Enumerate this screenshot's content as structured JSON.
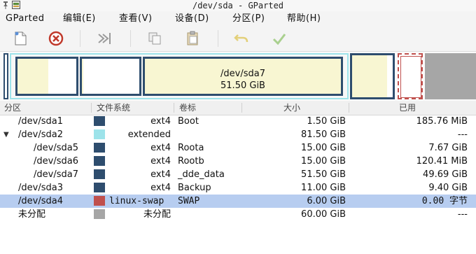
{
  "window": {
    "title": "/dev/sda - GParted"
  },
  "menubar": {
    "items": [
      {
        "label": "GParted"
      },
      {
        "label": "编辑(E)"
      },
      {
        "label": "查看(V)"
      },
      {
        "label": "设备(D)"
      },
      {
        "label": "分区(P)"
      },
      {
        "label": "帮助(H)"
      }
    ]
  },
  "toolbar": {
    "icons": [
      "new-partition-icon",
      "delete-partition-icon",
      "resize-move-icon",
      "copy-icon",
      "paste-icon",
      "undo-icon",
      "apply-icon"
    ]
  },
  "graph": {
    "selected_label": "/dev/sda7",
    "selected_size": "51.50 GiB"
  },
  "table": {
    "headers": [
      "分区",
      "文件系统",
      "卷标",
      "大小",
      "已用"
    ],
    "rows": [
      {
        "partition": "/dev/sda1",
        "fs": "ext4",
        "label": "Boot",
        "size": "1.50 GiB",
        "used": "185.76 MiB",
        "color": "#2e4d6e"
      },
      {
        "partition": "/dev/sda2",
        "fs": "extended",
        "label": "",
        "size": "81.50 GiB",
        "used": "---",
        "color": "#9de3ea"
      },
      {
        "partition": "/dev/sda5",
        "fs": "ext4",
        "label": "Roota",
        "size": "15.00 GiB",
        "used": "7.67 GiB",
        "color": "#2e4d6e"
      },
      {
        "partition": "/dev/sda6",
        "fs": "ext4",
        "label": "Rootb",
        "size": "15.00 GiB",
        "used": "120.41 MiB",
        "color": "#2e4d6e"
      },
      {
        "partition": "/dev/sda7",
        "fs": "ext4",
        "label": "_dde_data",
        "size": "51.50 GiB",
        "used": "49.69 GiB",
        "color": "#2e4d6e"
      },
      {
        "partition": "/dev/sda3",
        "fs": "ext4",
        "label": "Backup",
        "size": "11.00 GiB",
        "used": "9.40 GiB",
        "color": "#2e4d6e"
      },
      {
        "partition": "/dev/sda4",
        "fs": "linux-swap",
        "label": "SWAP",
        "size": "6.00 GiB",
        "used": "0.00 字节",
        "color": "#c0504d"
      },
      {
        "partition": "未分配",
        "fs": "未分配",
        "label": "",
        "size": "60.00 GiB",
        "used": "---",
        "color": "#a6a6a6"
      }
    ]
  },
  "colors": {
    "ext4": "#2e4d6e",
    "extended": "#9de3ea",
    "swap": "#c0504d",
    "unallocated": "#a6a6a6",
    "selection": "#b7cdf0"
  }
}
